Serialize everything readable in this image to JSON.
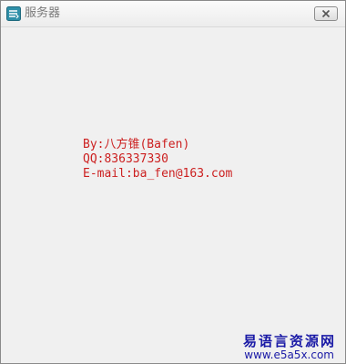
{
  "window": {
    "title": "服务器"
  },
  "icons": {
    "app": "app-logo-icon",
    "close": "close-icon"
  },
  "info": {
    "by": "By:八方锥(Bafen)",
    "qq": "QQ:836337330",
    "email": "E-mail:ba_fen@163.com"
  },
  "watermark": {
    "cn": "易语言资源网",
    "url": "www.e5a5x.com"
  },
  "colors": {
    "info_text": "#cc1f1f",
    "watermark": "#1a1aa6",
    "background": "#f0f0f0"
  }
}
